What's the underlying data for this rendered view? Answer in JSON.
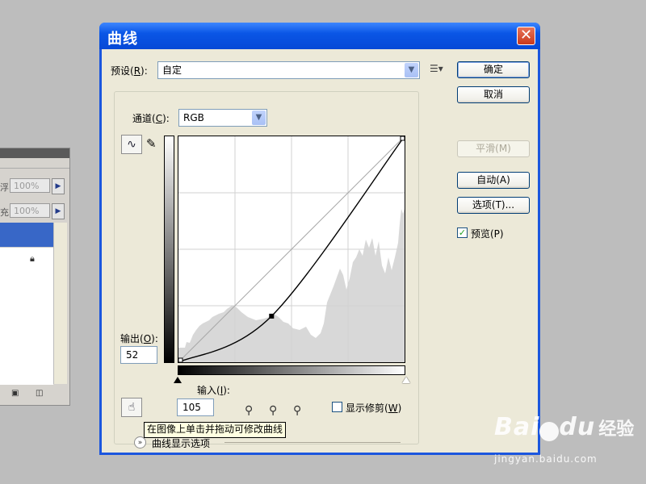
{
  "background_panel": {
    "percent_1": "100%",
    "percent_2": "100%",
    "label_1": "浮",
    "label_2": "充"
  },
  "dialog": {
    "title": "曲线",
    "preset_label": "预设(",
    "preset_key": "R",
    "preset_label_end": "):",
    "preset_value": "自定",
    "channel_label": "通道(",
    "channel_key": "C",
    "channel_label_end": "):",
    "channel_value": "RGB",
    "output_label": "输出(",
    "output_key": "O",
    "output_label_end": "):",
    "output_value": "52",
    "input_label": "输入(",
    "input_key": "I",
    "input_label_end": "):",
    "input_value": "105",
    "show_clipping_label": "显示修剪(",
    "show_clipping_key": "W",
    "show_clipping_end": ")",
    "tooltip": "在图像上单击并拖动可修改曲线",
    "display_options_label": "曲线显示选项"
  },
  "buttons": {
    "ok": "确定",
    "cancel": "取消",
    "smooth": "平滑(M)",
    "auto": "自动(A)",
    "options": "选项(T)...",
    "preview": "预览(P)",
    "preview_checked": true
  },
  "curve": {
    "control_point": {
      "input": 105,
      "output": 52
    },
    "endpoints": [
      [
        0,
        0
      ],
      [
        255,
        255
      ]
    ],
    "grid_divisions": 4
  },
  "watermark": {
    "logo": "Bai",
    "logo_2": "du",
    "jingyan": "经验",
    "url": "jingyan.baidu.com"
  },
  "colors": {
    "title_bar": "#0a56e6",
    "dialog_face": "#ece9d8",
    "histogram": "#d8d8d8",
    "selection": "#3867c7"
  }
}
